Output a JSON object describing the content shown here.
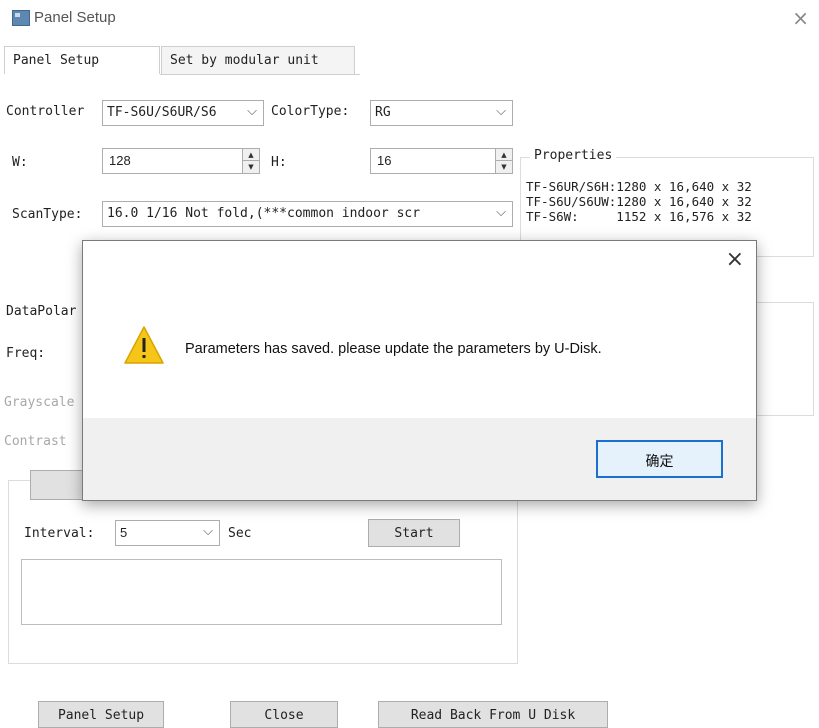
{
  "window": {
    "title": "Panel Setup",
    "close_glyph": "×"
  },
  "tabs": [
    {
      "label": "Panel Setup",
      "active": true
    },
    {
      "label": "Set by modular unit",
      "active": false
    }
  ],
  "form": {
    "controller_label": "Controller",
    "controller_value": "TF-S6U/S6UR/S6",
    "colortype_label": "ColorType:",
    "colortype_value": "RG",
    "w_label": "W:",
    "w_value": "128",
    "h_label": "H:",
    "h_value": "16",
    "scantype_label": "ScanType:",
    "scantype_value": "16.0 1/16 Not fold,(***common indoor scr",
    "datapolar_label": "DataPolar",
    "freq_label": "Freq:",
    "grayscale_label": "Grayscale",
    "contrast_label": "Contrast"
  },
  "properties": {
    "title": "Properties",
    "lines": [
      "TF-S6UR/S6H:1280 x 16,640 x 32",
      "TF-S6U/S6UW:1280 x 16,640 x 32",
      "TF-S6W:     1152 x 16,576 x 32"
    ]
  },
  "test": {
    "interval_label": "Interval:",
    "interval_value": "5",
    "sec_label": "Sec",
    "start_label": "Start"
  },
  "bottom_buttons": {
    "panel_setup": "Panel Setup",
    "close": "Close",
    "read_back": "Read Back From U Disk"
  },
  "dialog": {
    "message": "Parameters has saved. please update the parameters by U-Disk.",
    "ok_label": "确定",
    "close_glyph": "×",
    "icon": "warning-icon"
  },
  "colors": {
    "ok_border": "#1a6fd1",
    "warning_fill": "#f5c518"
  }
}
